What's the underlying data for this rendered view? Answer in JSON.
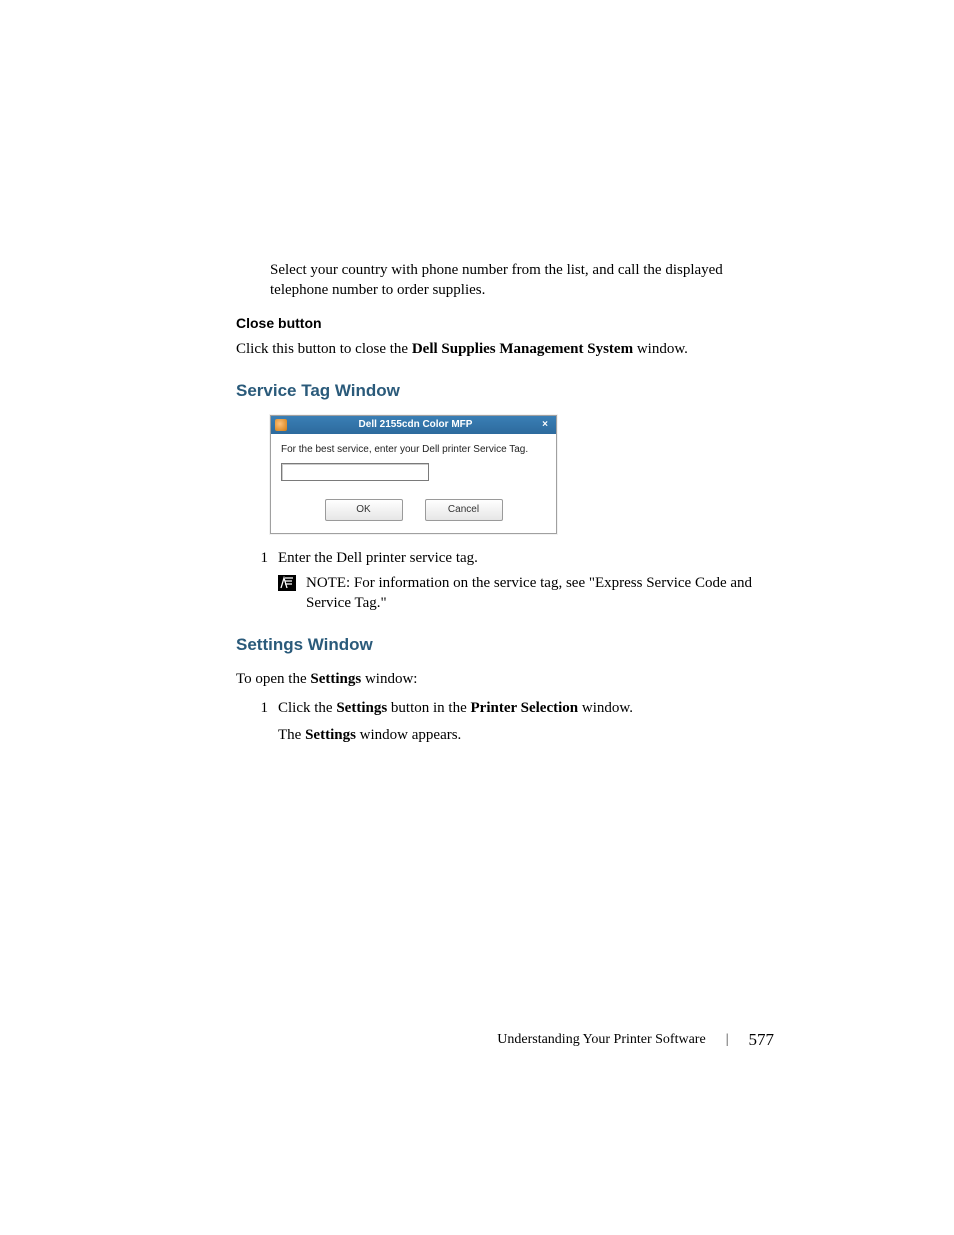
{
  "intro_paragraph": "Select your country with phone number from the list, and call the displayed telephone number to order supplies.",
  "close_button": {
    "heading": "Close button",
    "text_before": "Click this button to close the ",
    "bold": "Dell Supplies Management System",
    "text_after": " window."
  },
  "service_tag": {
    "heading": "Service Tag Window",
    "dialog": {
      "title": "Dell 2155cdn Color MFP",
      "close_glyph": "×",
      "prompt": "For the best service, enter your Dell printer Service Tag.",
      "input_value": "",
      "ok_label": "OK",
      "cancel_label": "Cancel"
    },
    "step1_num": "1",
    "step1_text": "Enter the Dell printer service tag.",
    "note_label": "NOTE: ",
    "note_text": "For information on the service tag, see \"Express Service Code and Service Tag.\""
  },
  "settings": {
    "heading": "Settings Window",
    "intro_before": "To open the ",
    "intro_bold": "Settings",
    "intro_after": " window:",
    "step1_num": "1",
    "step1_a": "Click the ",
    "step1_b1": "Settings",
    "step1_c": " button in the ",
    "step1_b2": "Printer Selection",
    "step1_d": " window.",
    "step1_line2_a": "The ",
    "step1_line2_b": "Settings",
    "step1_line2_c": " window appears."
  },
  "footer": {
    "section": "Understanding Your Printer Software",
    "page": "577"
  }
}
